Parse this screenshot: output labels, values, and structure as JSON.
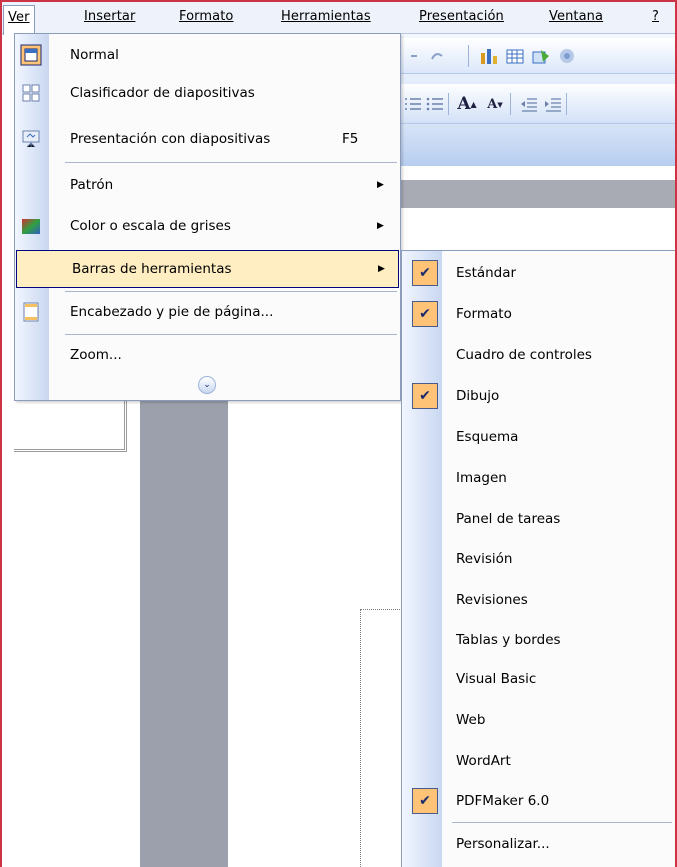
{
  "menubar": {
    "items": [
      {
        "label": "Ver",
        "active": true
      },
      {
        "label": "Insertar"
      },
      {
        "label": "Formato"
      },
      {
        "label": "Herramientas"
      },
      {
        "label": "Presentación"
      },
      {
        "label": "Ventana"
      },
      {
        "label": "?"
      }
    ]
  },
  "ver_menu": {
    "items": [
      {
        "label": "Normal",
        "icon": "normal-view-icon"
      },
      {
        "label": "Clasificador de diapositivas",
        "icon": "slide-sorter-icon"
      },
      {
        "label": "Presentación con diapositivas",
        "shortcut": "F5",
        "icon": "slideshow-icon"
      },
      {
        "label": "Patrón",
        "has_submenu": true
      },
      {
        "label": "Color o escala de grises",
        "has_submenu": true,
        "icon": "color-grayscale-icon"
      },
      {
        "label": "Barras de herramientas",
        "has_submenu": true,
        "highlighted": true
      },
      {
        "label": "Encabezado y pie de página...",
        "icon": "header-footer-icon"
      },
      {
        "label": "Zoom..."
      }
    ],
    "expand_icon": "expand-menu-chevron-icon"
  },
  "toolbars_submenu": {
    "items": [
      {
        "label": "Estándar",
        "checked": true
      },
      {
        "label": "Formato",
        "checked": true
      },
      {
        "label": "Cuadro de controles",
        "checked": false
      },
      {
        "label": "Dibujo",
        "checked": true
      },
      {
        "label": "Esquema",
        "checked": false
      },
      {
        "label": "Imagen",
        "checked": false
      },
      {
        "label": "Panel de tareas",
        "checked": false
      },
      {
        "label": "Revisión",
        "checked": false
      },
      {
        "label": "Revisiones",
        "checked": false
      },
      {
        "label": "Tablas y bordes",
        "checked": false
      },
      {
        "label": "Visual Basic",
        "checked": false
      },
      {
        "label": "Web",
        "checked": false
      },
      {
        "label": "WordArt",
        "checked": false
      },
      {
        "label": "PDFMaker 6.0",
        "checked": true
      },
      {
        "label": "Personalizar...",
        "checked": false
      }
    ],
    "check_glyph": "✔"
  },
  "colors": {
    "menu_highlight": "#ffeec2",
    "check_bg": "#ffc378",
    "gutter_start": "#f2f6ff",
    "gutter_end": "#c8d7f0",
    "frame": "#cc3344"
  }
}
